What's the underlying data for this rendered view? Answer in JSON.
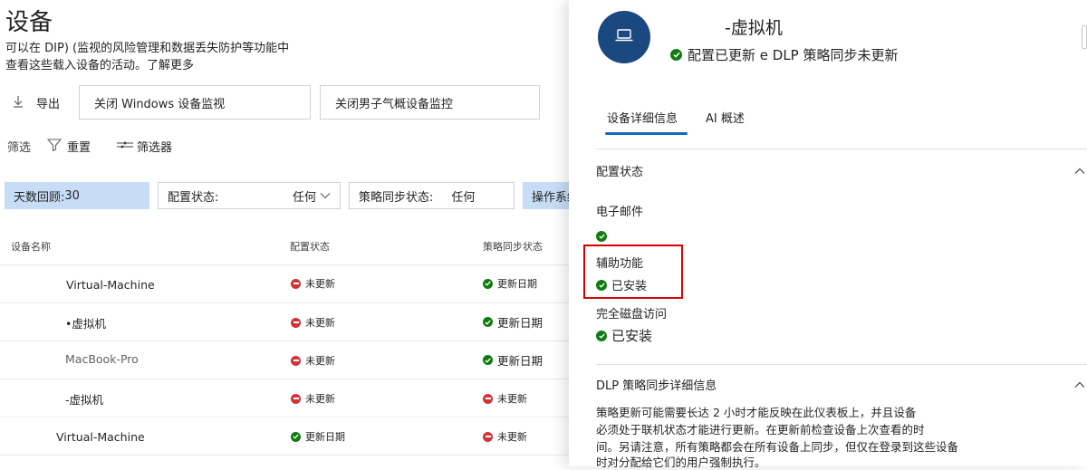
{
  "page": {
    "title": "设备",
    "description_line1": "可以在 DIP) (监视的风险管理和数据丢失防护等功能中",
    "description_line2": "查看这些载入设备的活动。",
    "learn_more": "了解更多"
  },
  "toolbar": {
    "export_label": "导出",
    "windows_monitor_button": "关闭 Windows 设备监视",
    "mac_monitor_button": "关闭男子气概设备监控",
    "filter_label": "筛选",
    "reset_label": "重置",
    "filter_picker_label": "筛选器"
  },
  "filters": {
    "days_label": "天数回顾:",
    "days_value": "30",
    "config_label": "配置状态:",
    "config_value": "任何",
    "policy_label": "策略同步状态:",
    "policy_value": "任何",
    "os_label": "操作系统"
  },
  "table": {
    "columns": [
      "设备名称",
      "配置状态",
      "策略同步状态"
    ],
    "rows": [
      {
        "name": "Virtual-Machine",
        "config": "未更新",
        "config_ok": false,
        "policy": "更新日期",
        "policy_ok": true
      },
      {
        "name": "•虚拟机",
        "config": "未更新",
        "config_ok": false,
        "policy": "更新日期",
        "policy_ok": true
      },
      {
        "name": "MacBook-Pro",
        "config": "未更新",
        "config_ok": false,
        "policy": "更新日期",
        "policy_ok": true
      },
      {
        "name": "-虚拟机",
        "config": "未更新",
        "config_ok": false,
        "policy": "未更新",
        "policy_ok": false
      },
      {
        "name": "Virtual-Machine",
        "config": "更新日期",
        "config_ok": true,
        "policy": "未更新",
        "policy_ok": false
      }
    ]
  },
  "panel": {
    "device_name": "-虚拟机",
    "status_text": "配置已更新 e DLP 策略同步未更新",
    "tabs": [
      "设备详细信息",
      "AI 概述"
    ],
    "config_section_title": "配置状态",
    "email_label": "电子邮件",
    "accessibility_label": "辅助功能",
    "accessibility_status": "已安装",
    "full_disk_label": "完全磁盘访问",
    "full_disk_status": "已安装",
    "dlp_section_title": "DLP 策略同步详细信息",
    "dlp_text": [
      "策略更新可能需要长达 2 小时才能反映在此仪表板上，并且设备",
      "必须处于联机状态才能进行更新。在更新前检查设备上次查看的时",
      "间。另请注意，所有策略都会在所有设备上同步，但仅在登录到这些设备",
      "时对分配给它们的用户强制执行。"
    ]
  },
  "colors": {
    "accent": "#0f6cbd",
    "avatar": "#1c4880",
    "status_ok": "#107c10",
    "status_bad": "#d13438",
    "highlight": "#d80000",
    "filter_chip": "#c7dcf5"
  },
  "icons": [
    "download-icon",
    "filter-icon",
    "filter-settings-icon",
    "chevron-down-icon",
    "laptop-icon",
    "check-circle-icon",
    "minus-circle-icon",
    "chevron-up-icon"
  ]
}
